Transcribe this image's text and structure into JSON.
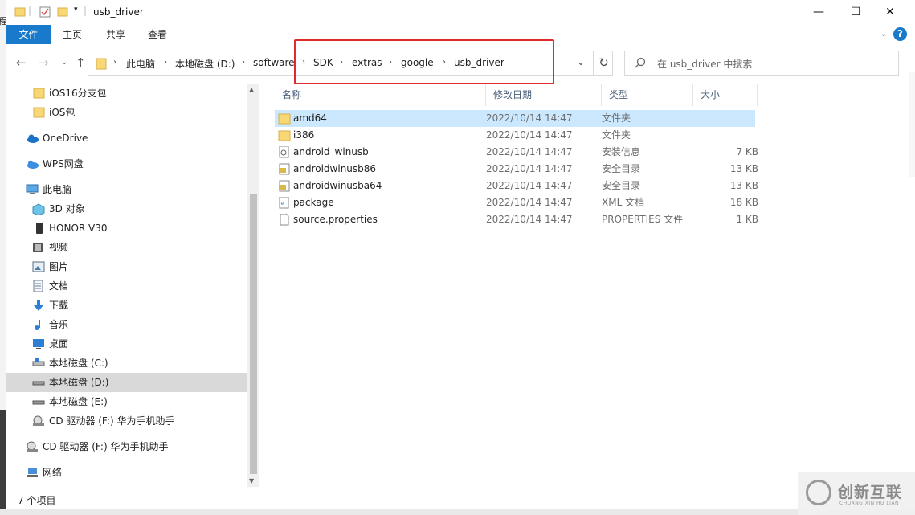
{
  "window": {
    "title": "usb_driver",
    "quick_access": [
      "folder-icon",
      "properties-icon",
      "new-folder-icon",
      "customize-dropdown"
    ]
  },
  "ribbon": {
    "tabs": [
      {
        "label": "文件",
        "active": true
      },
      {
        "label": "主页",
        "active": false
      },
      {
        "label": "共享",
        "active": false
      },
      {
        "label": "查看",
        "active": false
      }
    ],
    "help": "?"
  },
  "address": {
    "crumbs": [
      "此电脑",
      "本地磁盘 (D:)",
      "software",
      "SDK",
      "extras",
      "google",
      "usb_driver"
    ]
  },
  "search": {
    "placeholder": "在 usb_driver 中搜索"
  },
  "sidebar": {
    "items": [
      {
        "label": "iOS16分支包",
        "icon": "folder-icon"
      },
      {
        "label": "iOS包",
        "icon": "folder-icon"
      },
      {
        "label": "OneDrive",
        "icon": "onedrive-cloud-icon"
      },
      {
        "label": "WPS网盘",
        "icon": "wps-cloud-icon"
      },
      {
        "label": "此电脑",
        "icon": "this-pc-icon"
      },
      {
        "label": "3D 对象",
        "icon": "3d-objects-icon"
      },
      {
        "label": "HONOR V30",
        "icon": "phone-icon"
      },
      {
        "label": "视频",
        "icon": "video-icon"
      },
      {
        "label": "图片",
        "icon": "pictures-icon"
      },
      {
        "label": "文档",
        "icon": "documents-icon"
      },
      {
        "label": "下载",
        "icon": "download-icon"
      },
      {
        "label": "音乐",
        "icon": "music-icon"
      },
      {
        "label": "桌面",
        "icon": "desktop-icon"
      },
      {
        "label": "本地磁盘 (C:)",
        "icon": "drive-icon"
      },
      {
        "label": "本地磁盘 (D:)",
        "icon": "drive-icon",
        "selected": true
      },
      {
        "label": "本地磁盘 (E:)",
        "icon": "drive-icon"
      },
      {
        "label": "CD 驱动器 (F:) 华为手机助手",
        "icon": "cd-drive-icon"
      },
      {
        "label": "CD 驱动器 (F:) 华为手机助手",
        "icon": "cd-drive-icon"
      },
      {
        "label": "网络",
        "icon": "network-icon"
      }
    ]
  },
  "columns": {
    "name": "名称",
    "date": "修改日期",
    "type": "类型",
    "size": "大小"
  },
  "files": [
    {
      "name": "amd64",
      "date": "2022/10/14 14:47",
      "type": "文件夹",
      "size": "",
      "icon": "folder-icon",
      "selected": true
    },
    {
      "name": "i386",
      "date": "2022/10/14 14:47",
      "type": "文件夹",
      "size": "",
      "icon": "folder-icon"
    },
    {
      "name": "android_winusb",
      "date": "2022/10/14 14:47",
      "type": "安装信息",
      "size": "7 KB",
      "icon": "setup-info-icon"
    },
    {
      "name": "androidwinusb86",
      "date": "2022/10/14 14:47",
      "type": "安全目录",
      "size": "13 KB",
      "icon": "security-catalog-icon"
    },
    {
      "name": "androidwinusba64",
      "date": "2022/10/14 14:47",
      "type": "安全目录",
      "size": "13 KB",
      "icon": "security-catalog-icon"
    },
    {
      "name": "package",
      "date": "2022/10/14 14:47",
      "type": "XML 文档",
      "size": "18 KB",
      "icon": "xml-file-icon"
    },
    {
      "name": "source.properties",
      "date": "2022/10/14 14:47",
      "type": "PROPERTIES 文件",
      "size": "1 KB",
      "icon": "file-icon"
    }
  ],
  "status": {
    "count": "7 个项目"
  },
  "watermark": {
    "cn": "创新互联",
    "en": "CHUANG XIN HU LIAN"
  },
  "colors": {
    "accent": "#1979ca",
    "selected_row": "#cce8ff",
    "selected_nav": "#d9d9d9",
    "highlight_box": "#e02b2b",
    "folder": "#f8d775"
  }
}
